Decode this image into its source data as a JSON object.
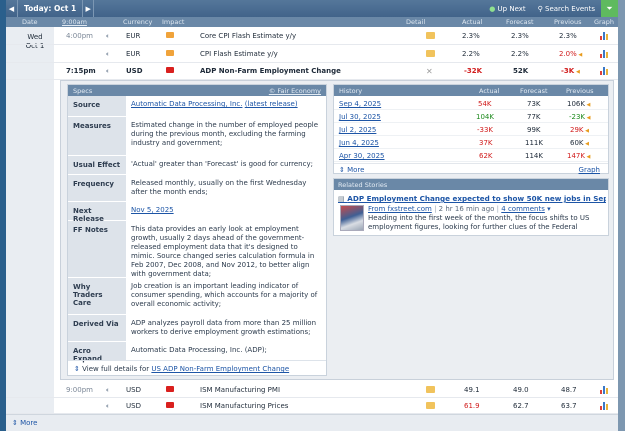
{
  "topbar": {
    "prev_icon": "chevron-left",
    "today_label": "Today: Oct 1",
    "next_icon": "chevron-right",
    "up_next_label": "Up Next",
    "search_events_label": "Search Events",
    "filter_icon": "filter"
  },
  "headers": [
    "Date",
    "9:00am",
    "Currency",
    "Impact",
    "Detail",
    "Actual",
    "Forecast",
    "Previous",
    "Graph"
  ],
  "date_cell": {
    "day": "Wed",
    "date": "Oct 1"
  },
  "events_top": [
    {
      "time": "4:00pm",
      "currency": "EUR",
      "impact": "orange",
      "event": "Core CPI Flash Estimate y/y",
      "actual": "2.3%",
      "forecast": "2.3%",
      "previous": "2.3%"
    },
    {
      "time": "",
      "currency": "EUR",
      "impact": "orange",
      "event": "CPI Flash Estimate y/y",
      "actual": "2.2%",
      "forecast": "2.2%",
      "previous": "2.0%"
    },
    {
      "time": "7:15pm",
      "currency": "USD",
      "impact": "red",
      "event": "ADP Non-Farm Employment Change",
      "actual": "-32K",
      "forecast": "52K",
      "previous": "-3K"
    }
  ],
  "specs": {
    "header": "Specs",
    "source_link": "© Fair Economy",
    "rows": [
      {
        "key": "Source",
        "value": "Automatic Data Processing, Inc.",
        "extra": "(latest release)"
      },
      {
        "key": "Measures",
        "value": "Estimated change in the number of employed people during the previous month, excluding the farming industry and government;"
      },
      {
        "key": "Usual Effect",
        "value": "'Actual' greater than 'Forecast' is good for currency;"
      },
      {
        "key": "Frequency",
        "value": "Released monthly, usually on the first Wednesday after the month ends;"
      },
      {
        "key": "Next Release",
        "value": "Nov 5, 2025"
      },
      {
        "key": "FF Notes",
        "value": "This data provides an early look at employment growth, usually 2 days ahead of the government-released employment data that it's designed to mimic. Source changed series calculation formula in Feb 2007, Dec 2008, and Nov 2012, to better align with government data;"
      },
      {
        "key": "Why Traders Care",
        "value": "Job creation is an important leading indicator of consumer spending, which accounts for a majority of overall economic activity;"
      },
      {
        "key": "Derived Via",
        "value": "ADP analyzes payroll data from more than 25 million workers to derive employment growth estimations;"
      },
      {
        "key": "Acro Expand",
        "value": "Automatic Data Processing, Inc. (ADP);"
      }
    ],
    "view_full_prefix": "View full details for",
    "view_full_link": "US ADP Non-Farm Employment Change"
  },
  "history": {
    "headers": [
      "History",
      "Actual",
      "Forecast",
      "Previous"
    ],
    "rows": [
      {
        "date": "Sep 4, 2025",
        "actual": "54K",
        "forecast": "73K",
        "previous": "106K"
      },
      {
        "date": "Jul 30, 2025",
        "actual": "104K",
        "forecast": "77K",
        "previous": "-23K"
      },
      {
        "date": "Jul 2, 2025",
        "actual": "-33K",
        "forecast": "99K",
        "previous": "29K"
      },
      {
        "date": "Jun 4, 2025",
        "actual": "37K",
        "forecast": "111K",
        "previous": "60K"
      },
      {
        "date": "Apr 30, 2025",
        "actual": "62K",
        "forecast": "114K",
        "previous": "147K"
      }
    ],
    "more_label": "More",
    "graph_label": "Graph"
  },
  "related": {
    "header": "Related Stories",
    "title": "ADP Employment Change expected to show 50K new jobs in Septem",
    "source": "From fxstreet.com",
    "time": "2 hr 16 min ago",
    "comments": "4 comments",
    "body": "Heading into the first week of the month, the focus shifts to US employment figures, looking for further clues of the Federal"
  },
  "events_bottom": [
    {
      "time": "9:00pm",
      "currency": "USD",
      "impact": "red",
      "event": "ISM Manufacturing PMI",
      "actual": "49.1",
      "forecast": "49.0",
      "previous": "48.7"
    },
    {
      "time": "",
      "currency": "USD",
      "impact": "red",
      "event": "ISM Manufacturing Prices",
      "actual": "61.9",
      "forecast": "62.7",
      "previous": "63.7"
    }
  ],
  "footer": {
    "more_label": "More"
  },
  "colors": {
    "header_blue": "#6a88a7",
    "topbar_blue": "#4a6d93",
    "filter_green": "#5fba5f",
    "red": "#d11b1b",
    "green": "#1d8a1d",
    "impact_orange": "#f0a33a",
    "impact_red": "#d9201e"
  }
}
